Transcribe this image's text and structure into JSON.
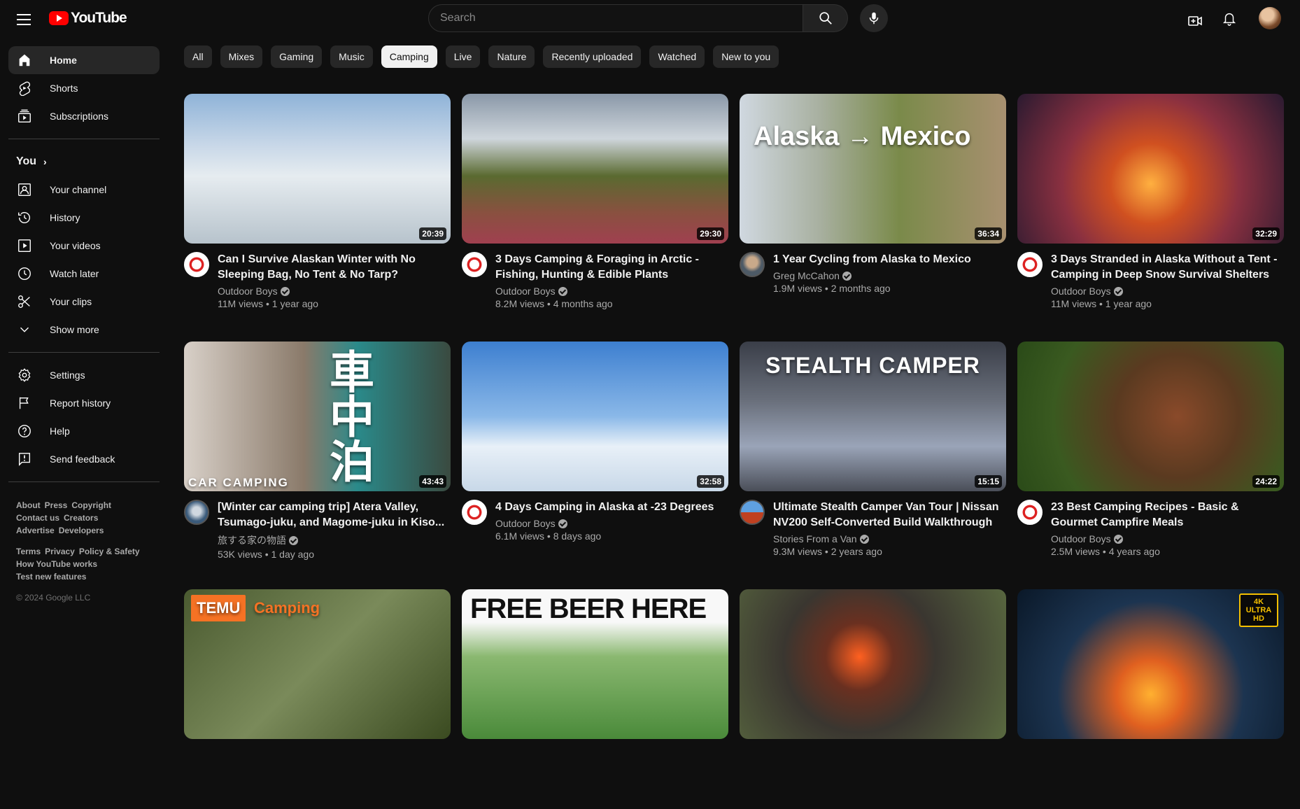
{
  "header": {
    "logo_text": "YouTube",
    "search_placeholder": "Search"
  },
  "sidebar": {
    "main": [
      {
        "label": "Home",
        "icon": "home-icon"
      },
      {
        "label": "Shorts",
        "icon": "shorts-icon"
      },
      {
        "label": "Subscriptions",
        "icon": "subscriptions-icon"
      }
    ],
    "you_label": "You",
    "you_items": [
      {
        "label": "Your channel",
        "icon": "channel-icon"
      },
      {
        "label": "History",
        "icon": "history-icon"
      },
      {
        "label": "Your videos",
        "icon": "videos-icon"
      },
      {
        "label": "Watch later",
        "icon": "clock-icon"
      },
      {
        "label": "Your clips",
        "icon": "scissors-icon"
      },
      {
        "label": "Show more",
        "icon": "chevron-down-icon"
      }
    ],
    "settings_items": [
      {
        "label": "Settings",
        "icon": "gear-icon"
      },
      {
        "label": "Report history",
        "icon": "flag-icon"
      },
      {
        "label": "Help",
        "icon": "help-icon"
      },
      {
        "label": "Send feedback",
        "icon": "feedback-icon"
      }
    ],
    "footer1": [
      "About",
      "Press",
      "Copyright",
      "Contact us",
      "Creators",
      "Advertise",
      "Developers"
    ],
    "footer2": [
      "Terms",
      "Privacy",
      "Policy & Safety",
      "How YouTube works",
      "Test new features"
    ],
    "copyright": "© 2024 Google LLC"
  },
  "chips": [
    "All",
    "Mixes",
    "Gaming",
    "Music",
    "Camping",
    "Live",
    "Nature",
    "Recently uploaded",
    "Watched",
    "New to you"
  ],
  "selected_chip": "Camping",
  "videos": [
    {
      "title": "Can I Survive Alaskan Winter with No Sleeping Bag, No Tent & No Tarp?",
      "channel": "Outdoor Boys",
      "verified": true,
      "views": "11M views",
      "age": "1 year ago",
      "duration": "20:39",
      "avatar": "outdoor"
    },
    {
      "title": "3 Days Camping & Foraging in Arctic - Fishing, Hunting & Edible Plants",
      "channel": "Outdoor Boys",
      "verified": true,
      "views": "8.2M views",
      "age": "4 months ago",
      "duration": "29:30",
      "avatar": "outdoor"
    },
    {
      "title": "1 Year Cycling from Alaska to Mexico",
      "channel": "Greg McCahon",
      "verified": true,
      "views": "1.9M views",
      "age": "2 months ago",
      "duration": "36:34",
      "avatar": "greg",
      "thumb_text": "Alaska → Mexico"
    },
    {
      "title": "3 Days Stranded in Alaska Without a Tent - Camping in Deep Snow Survival Shelters",
      "channel": "Outdoor Boys",
      "verified": true,
      "views": "11M views",
      "age": "1 year ago",
      "duration": "32:29",
      "avatar": "outdoor"
    },
    {
      "title": "[Winter car camping trip] Atera Valley, Tsumago-juku, and Magome-juku in Kiso...",
      "channel": "旅する家の物語",
      "verified": true,
      "views": "53K views",
      "age": "1 day ago",
      "duration": "43:43",
      "avatar": "tabi",
      "thumb_text": "車中泊",
      "thumb_text2": "CAR CAMPING"
    },
    {
      "title": "4 Days Camping in Alaska at -23 Degrees",
      "channel": "Outdoor Boys",
      "verified": true,
      "views": "6.1M views",
      "age": "8 days ago",
      "duration": "32:58",
      "avatar": "outdoor"
    },
    {
      "title": "Ultimate Stealth Camper Van Tour | Nissan NV200 Self-Converted Build Walkthrough",
      "channel": "Stories From a Van",
      "verified": true,
      "views": "9.3M views",
      "age": "2 years ago",
      "duration": "15:15",
      "avatar": "stories",
      "thumb_text": "STEALTH CAMPER"
    },
    {
      "title": "23 Best Camping Recipes - Basic & Gourmet Campfire Meals",
      "channel": "Outdoor Boys",
      "verified": true,
      "views": "2.5M views",
      "age": "4 years ago",
      "duration": "24:22",
      "avatar": "outdoor"
    },
    {
      "title": "",
      "channel": "",
      "views": "",
      "age": "",
      "duration": "",
      "avatar": "",
      "thumb_text": "TEMU",
      "thumb_text2": "Camping"
    },
    {
      "title": "",
      "channel": "",
      "views": "",
      "age": "",
      "duration": "",
      "avatar": "",
      "thumb_text": "FREE BEER HERE"
    },
    {
      "title": "",
      "channel": "",
      "views": "",
      "age": "",
      "duration": "",
      "avatar": ""
    },
    {
      "title": "",
      "channel": "",
      "views": "",
      "age": "",
      "duration": "",
      "avatar": "",
      "thumb_text": "4K ULTRA HD"
    }
  ],
  "thumb_colors": [
    "#7c9bb8",
    "#6f7a3c",
    "#8a7c55",
    "#b8502e",
    "#6b6055",
    "#3d6fb3",
    "#5a5e6a",
    "#4a3a2a",
    "#6a7a4a",
    "#5aa04a",
    "#3a3a32",
    "#1c3450"
  ]
}
